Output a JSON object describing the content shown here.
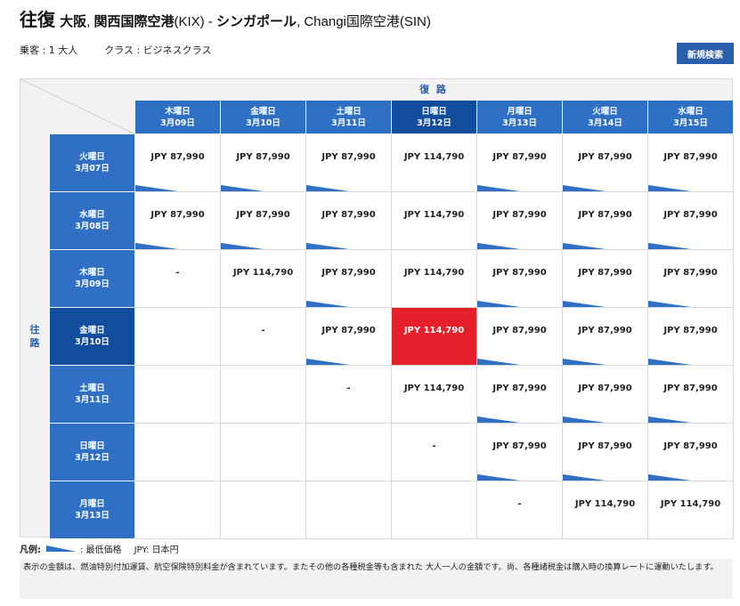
{
  "header": {
    "trip_type": "往復",
    "origin_city": "大阪",
    "origin_airport": "関西国際空港",
    "origin_code": "(KIX)",
    "dest_city": "シンガポール",
    "dest_airport": "Changi国際空港",
    "dest_code": "(SIN)"
  },
  "meta": {
    "passengers": "乗客 : 1 大人",
    "cabin": "クラス : ビジネスクラス"
  },
  "new_search_label": "新規検索",
  "matrix": {
    "return_label": "復 路",
    "outbound_label": [
      "往",
      "路"
    ],
    "return_dates": [
      {
        "day": "木曜日",
        "date": "3月09日"
      },
      {
        "day": "金曜日",
        "date": "3月10日"
      },
      {
        "day": "土曜日",
        "date": "3月11日"
      },
      {
        "day": "日曜日",
        "date": "3月12日"
      },
      {
        "day": "月曜日",
        "date": "3月13日"
      },
      {
        "day": "火曜日",
        "date": "3月14日"
      },
      {
        "day": "水曜日",
        "date": "3月15日"
      }
    ],
    "selected_return_index": 3,
    "outbound_dates": [
      {
        "day": "火曜日",
        "date": "3月07日"
      },
      {
        "day": "水曜日",
        "date": "3月08日"
      },
      {
        "day": "木曜日",
        "date": "3月09日"
      },
      {
        "day": "金曜日",
        "date": "3月10日"
      },
      {
        "day": "土曜日",
        "date": "3月11日"
      },
      {
        "day": "日曜日",
        "date": "3月12日"
      },
      {
        "day": "月曜日",
        "date": "3月13日"
      }
    ],
    "selected_outbound_index": 3,
    "rows": [
      [
        {
          "price": "JPY 87,990",
          "lowest": true
        },
        {
          "price": "JPY 87,990",
          "lowest": true
        },
        {
          "price": "JPY 87,990",
          "lowest": true
        },
        {
          "price": "JPY 114,790",
          "lowest": false
        },
        {
          "price": "JPY 87,990",
          "lowest": true
        },
        {
          "price": "JPY 87,990",
          "lowest": true
        },
        {
          "price": "JPY 87,990",
          "lowest": true
        }
      ],
      [
        {
          "price": "JPY 87,990",
          "lowest": true
        },
        {
          "price": "JPY 87,990",
          "lowest": true
        },
        {
          "price": "JPY 87,990",
          "lowest": true
        },
        {
          "price": "JPY 114,790",
          "lowest": false
        },
        {
          "price": "JPY 87,990",
          "lowest": true
        },
        {
          "price": "JPY 87,990",
          "lowest": true
        },
        {
          "price": "JPY 87,990",
          "lowest": true
        }
      ],
      [
        {
          "price": "-",
          "lowest": false
        },
        {
          "price": "JPY 114,790",
          "lowest": false
        },
        {
          "price": "JPY 87,990",
          "lowest": true
        },
        {
          "price": "JPY 114,790",
          "lowest": false
        },
        {
          "price": "JPY 87,990",
          "lowest": true
        },
        {
          "price": "JPY 87,990",
          "lowest": true
        },
        {
          "price": "JPY 87,990",
          "lowest": true
        }
      ],
      [
        {
          "price": "",
          "lowest": false
        },
        {
          "price": "-",
          "lowest": false
        },
        {
          "price": "JPY 87,990",
          "lowest": true
        },
        {
          "price": "JPY 114,790",
          "lowest": false,
          "selected": true
        },
        {
          "price": "JPY 87,990",
          "lowest": true
        },
        {
          "price": "JPY 87,990",
          "lowest": true
        },
        {
          "price": "JPY 87,990",
          "lowest": true
        }
      ],
      [
        {
          "price": "",
          "lowest": false
        },
        {
          "price": "",
          "lowest": false
        },
        {
          "price": "-",
          "lowest": false
        },
        {
          "price": "JPY 114,790",
          "lowest": false
        },
        {
          "price": "JPY 87,990",
          "lowest": true
        },
        {
          "price": "JPY 87,990",
          "lowest": true
        },
        {
          "price": "JPY 87,990",
          "lowest": true
        }
      ],
      [
        {
          "price": "",
          "lowest": false
        },
        {
          "price": "",
          "lowest": false
        },
        {
          "price": "",
          "lowest": false
        },
        {
          "price": "-",
          "lowest": false
        },
        {
          "price": "JPY 87,990",
          "lowest": true
        },
        {
          "price": "JPY 87,990",
          "lowest": true
        },
        {
          "price": "JPY 87,990",
          "lowest": true
        }
      ],
      [
        {
          "price": "",
          "lowest": false
        },
        {
          "price": "",
          "lowest": false
        },
        {
          "price": "",
          "lowest": false
        },
        {
          "price": "",
          "lowest": false
        },
        {
          "price": "-",
          "lowest": false
        },
        {
          "price": "JPY 114,790",
          "lowest": false
        },
        {
          "price": "JPY 114,790",
          "lowest": false
        }
      ]
    ]
  },
  "legend": {
    "label": "凡例:",
    "lowest_text": ": 最低価格",
    "currency_text": "JPY: 日本円"
  },
  "note": "表示の金額は、燃油特別付加運賃、航空保険特別料金が含まれています。またその他の各種税金等も含まれた 大人一人の金額です。尚、各種諸税金は購入時の換算レートに運動いたします。",
  "colors": {
    "header_blue": "#2f70c4",
    "header_selected": "#124c9c",
    "selected_cell": "#e5202a",
    "lowest_marker": "#2f70c4"
  }
}
